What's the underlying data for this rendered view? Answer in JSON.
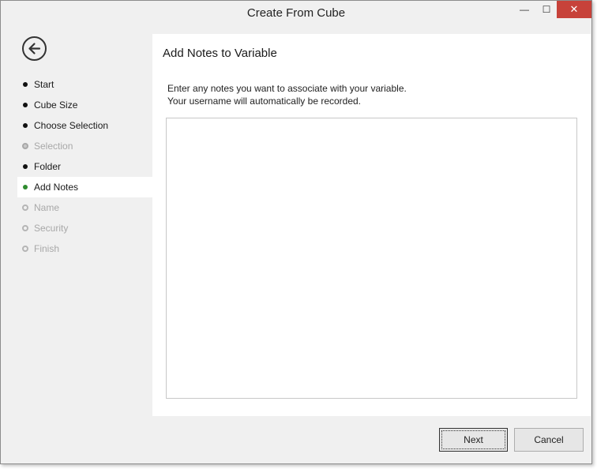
{
  "window": {
    "title": "Create From Cube",
    "minimize_glyph": "—",
    "maximize_glyph": "☐",
    "close_glyph": "✕"
  },
  "sidebar": {
    "back_icon": "back-arrow-icon",
    "steps": [
      {
        "label": "Start",
        "state": "completed"
      },
      {
        "label": "Cube Size",
        "state": "completed"
      },
      {
        "label": "Choose Selection",
        "state": "completed"
      },
      {
        "label": "Selection",
        "state": "skipped"
      },
      {
        "label": "Folder",
        "state": "completed"
      },
      {
        "label": "Add Notes",
        "state": "current"
      },
      {
        "label": "Name",
        "state": "pending"
      },
      {
        "label": "Security",
        "state": "pending"
      },
      {
        "label": "Finish",
        "state": "pending"
      }
    ]
  },
  "main": {
    "heading": "Add Notes to Variable",
    "instruction_line1": "Enter any notes you want to associate with your variable.",
    "instruction_line2": "Your username will automatically be recorded.",
    "notes_value": ""
  },
  "footer": {
    "next_label": "Next",
    "cancel_label": "Cancel"
  },
  "colors": {
    "current_step": "#2e8b2e",
    "close_button": "#c7423a"
  }
}
